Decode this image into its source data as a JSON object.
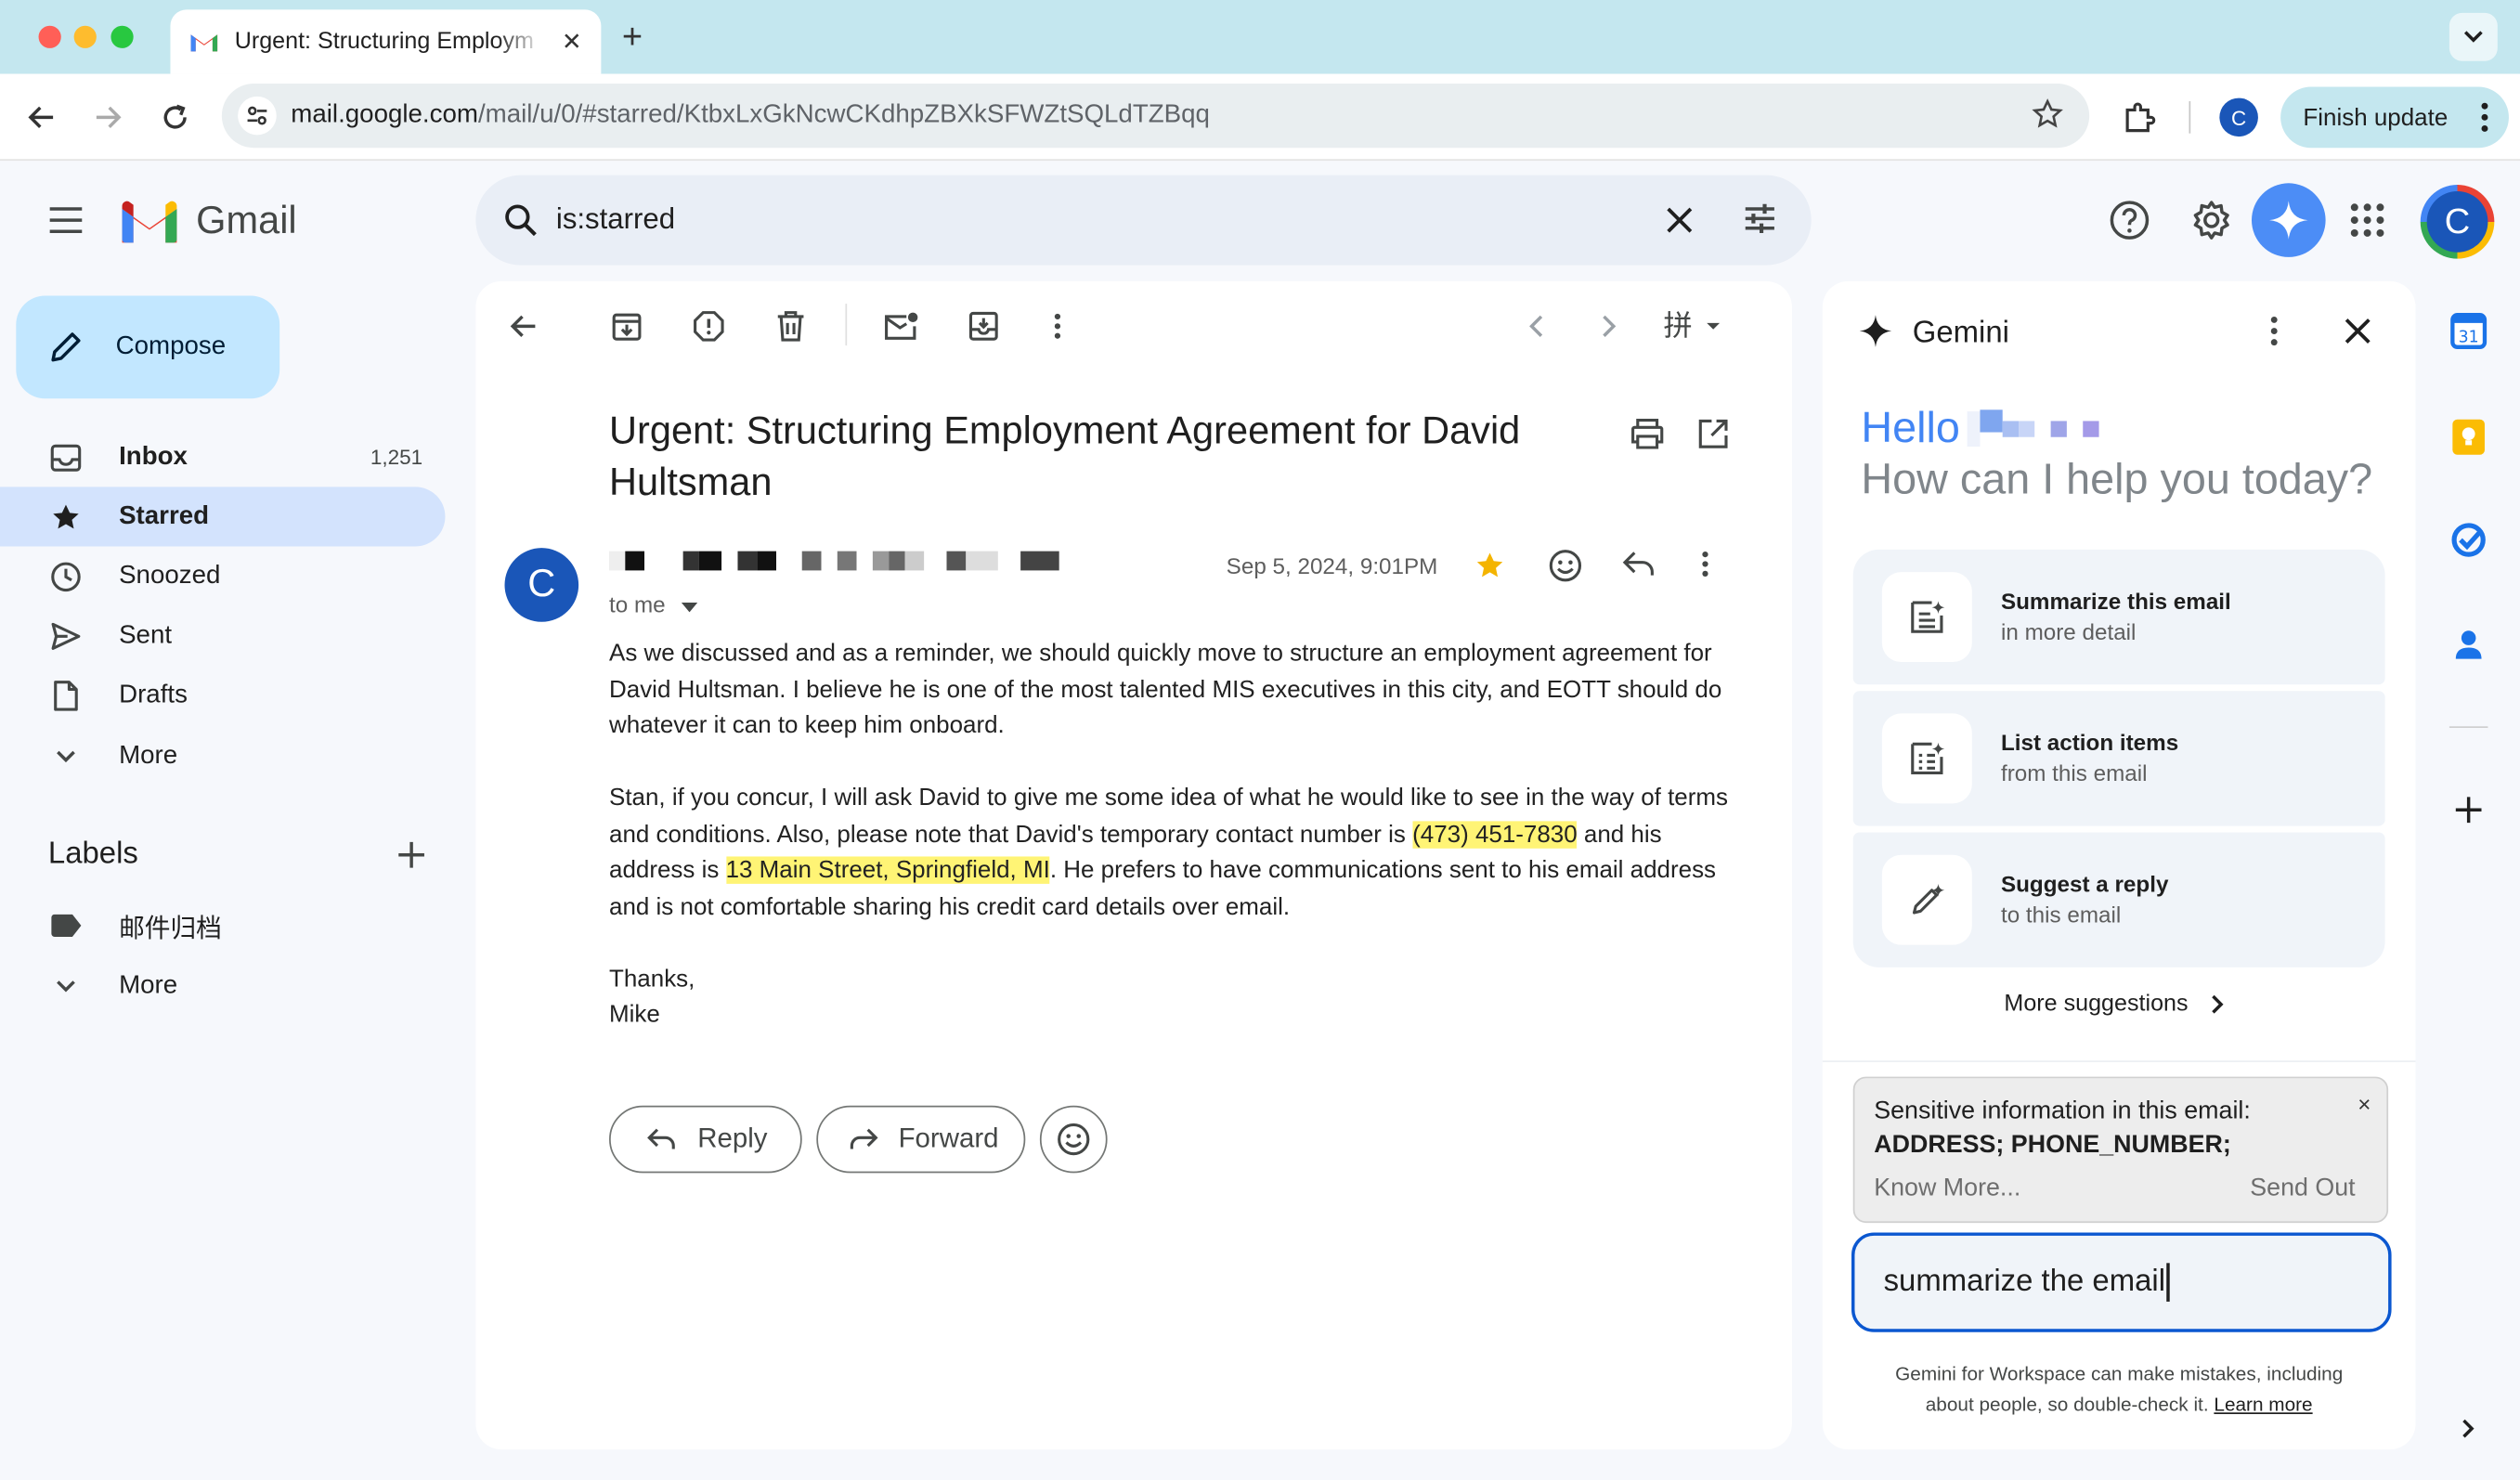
{
  "browser": {
    "tab_title": "Urgent: Structuring Employm",
    "url_host": "mail.google.com",
    "url_path": "/mail/u/0/#starred/KtbxLxGkNcwCKdhpZBXkSFWZtSQLdTZBqq",
    "profile_initial": "C",
    "finish_update_label": "Finish update"
  },
  "header": {
    "app_name": "Gmail",
    "search_query": "is:starred",
    "account_initial": "C"
  },
  "sidebar": {
    "compose_label": "Compose",
    "items": [
      {
        "label": "Inbox",
        "count": "1,251",
        "icon": "inbox-icon"
      },
      {
        "label": "Starred",
        "count": "",
        "icon": "star-icon"
      },
      {
        "label": "Snoozed",
        "count": "",
        "icon": "clock-icon"
      },
      {
        "label": "Sent",
        "count": "",
        "icon": "send-icon"
      },
      {
        "label": "Drafts",
        "count": "",
        "icon": "draft-icon"
      },
      {
        "label": "More",
        "count": "",
        "icon": "chevron-down-icon"
      }
    ],
    "labels_title": "Labels",
    "labels": [
      {
        "label": "邮件归档",
        "icon": "label-icon"
      }
    ],
    "labels_more": "More"
  },
  "email": {
    "subject": "Urgent: Structuring Employment Agreement for David Hultsman",
    "sender_initial": "C",
    "recipient": "to me",
    "date": "Sep 5, 2024, 9:01PM",
    "para1": "As we discussed and as a reminder, we should quickly move to structure an employment agreement for David Hultsman. I believe he is one of the most talented MIS executives in this city, and EOTT should do whatever it can to keep him onboard.",
    "para2_a": "Stan, if you concur, I will ask David to give me some idea of what he would like to see in the way of terms and conditions. Also, please note that David's temporary contact number is ",
    "phone": "(473) 451-7830",
    "para2_b": " and his address is ",
    "address": "13 Main Street, Springfield, MI",
    "para2_c": ". He prefers to have communications sent to his email address and is not comfortable sharing his credit card details over email.",
    "closing": "Thanks,",
    "signature": "Mike",
    "reply_label": "Reply",
    "forward_label": "Forward"
  },
  "gemini": {
    "title": "Gemini",
    "hello": "Hello",
    "help_prompt": "How can I help you today?",
    "suggestions": [
      {
        "title": "Summarize this email",
        "subtitle": "in more detail",
        "icon": "summarize-icon"
      },
      {
        "title": "List action items",
        "subtitle": "from this email",
        "icon": "list-icon"
      },
      {
        "title": "Suggest a reply",
        "subtitle": "to this email",
        "icon": "magic-pen-icon"
      }
    ],
    "more_suggestions": "More suggestions",
    "sensitive_title": "Sensitive information in this email:",
    "sensitive_types": "ADDRESS; PHONE_NUMBER;",
    "sensitive_close": "×",
    "know_more": "Know More...",
    "send_out": "Send Out",
    "input_value": "summarize the email",
    "disclaimer": "Gemini for Workspace can make mistakes, including about people, so double-check it.",
    "learn_more": "Learn more"
  },
  "colors": {
    "accent": "#0b57d0",
    "starred_bg": "#d3e3fd",
    "compose_bg": "#c2e7ff",
    "highlight": "#fff475",
    "star": "#f4b400"
  }
}
